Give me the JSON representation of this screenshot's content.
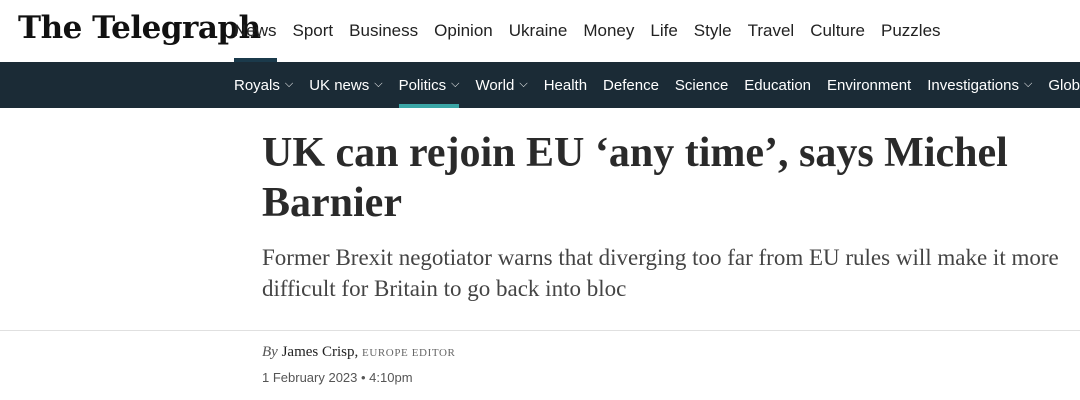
{
  "logo": "The Telegraph",
  "primary_nav": [
    "News",
    "Sport",
    "Business",
    "Opinion",
    "Ukraine",
    "Money",
    "Life",
    "Style",
    "Travel",
    "Culture",
    "Puzzles"
  ],
  "primary_active": "News",
  "sub_nav": [
    {
      "label": "Royals",
      "dropdown": true
    },
    {
      "label": "UK news",
      "dropdown": true
    },
    {
      "label": "Politics",
      "dropdown": true,
      "active": true
    },
    {
      "label": "World",
      "dropdown": true
    },
    {
      "label": "Health",
      "dropdown": false
    },
    {
      "label": "Defence",
      "dropdown": false
    },
    {
      "label": "Science",
      "dropdown": false
    },
    {
      "label": "Education",
      "dropdown": false
    },
    {
      "label": "Environment",
      "dropdown": false
    },
    {
      "label": "Investigations",
      "dropdown": true
    },
    {
      "label": "Global H",
      "dropdown": false
    }
  ],
  "article": {
    "headline": "UK can rejoin EU ‘any time’, says Michel Barnier",
    "standfirst": "Former Brexit negotiator warns that diverging too far from EU rules will make it more difficult for Britain to go back into bloc",
    "byline_prefix": "By",
    "author": "James Crisp,",
    "author_role": "Europe Editor",
    "date": "1 February 2023 • 4:10pm"
  }
}
